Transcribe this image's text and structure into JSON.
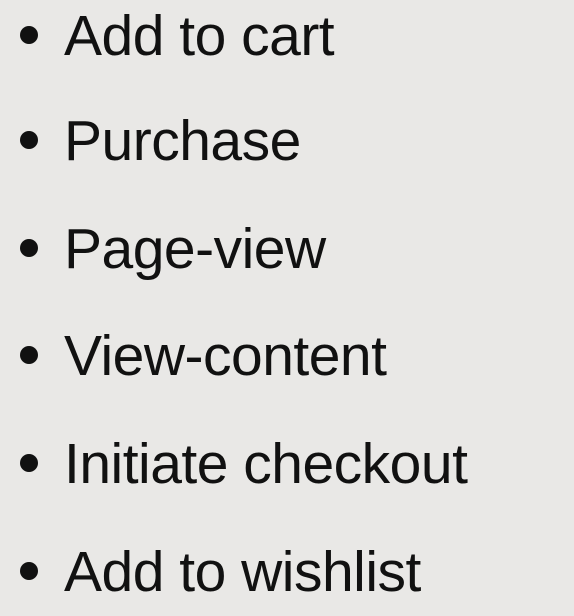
{
  "list": {
    "items": [
      "Add to cart",
      "Purchase",
      "Page-view",
      "View-content",
      "Initiate checkout",
      "Add to wishlist"
    ]
  },
  "colors": {
    "background": "#e9e8e6",
    "text": "#111111"
  }
}
